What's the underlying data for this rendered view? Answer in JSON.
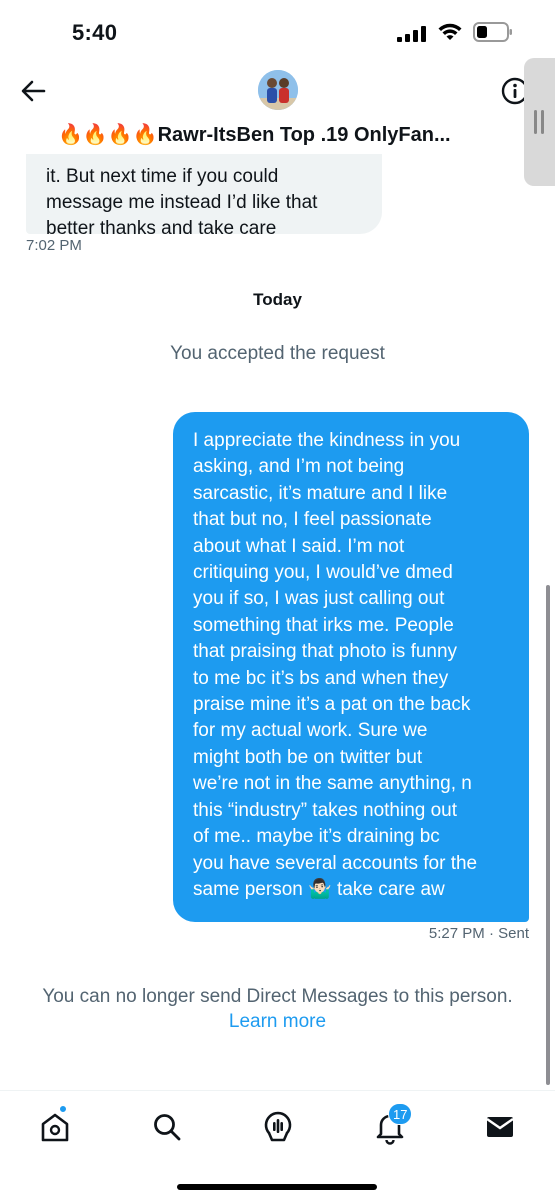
{
  "status_bar": {
    "time": "5:40"
  },
  "header": {
    "title": "🔥🔥🔥🔥Rawr-ItsBen Top .19 OnlyFan...",
    "back_icon": "arrow-left-icon",
    "info_icon": "info-icon"
  },
  "messages": {
    "received": {
      "lines": [
        "it. But next time if you could",
        "message me instead I’d like that",
        "better thanks and take care"
      ],
      "time": "7:02 PM"
    },
    "date_divider": "Today",
    "system": "You accepted the request",
    "sent": {
      "lines": [
        "I appreciate the kindness in you",
        "asking, and I’m not being",
        "sarcastic, it’s mature and I like",
        "that but no, I feel passionate",
        "about what I said. I’m not",
        "critiquing you, I would’ve dmed",
        "you if so, I was just calling out",
        "something that irks me. People",
        "that praising that photo is funny",
        "to me bc  it’s bs and when they",
        "praise mine it’s a pat on the back",
        "for my actual work. Sure we",
        "might both be on twitter but",
        "we’re not in the same anything, n",
        "this “industry” takes nothing out",
        "of me.. maybe it’s draining bc",
        "you have several accounts for the",
        "same person 🤷🏻‍♂️ take care aw"
      ],
      "time": "5:27 PM",
      "status": "· Sent"
    }
  },
  "notice": {
    "text": "You can no longer send Direct Messages to this person.",
    "link": "Learn more"
  },
  "tab_bar": {
    "items": [
      {
        "name": "home",
        "icon": "home-icon"
      },
      {
        "name": "search",
        "icon": "search-icon"
      },
      {
        "name": "spaces",
        "icon": "spaces-icon"
      },
      {
        "name": "notifications",
        "icon": "bell-icon"
      },
      {
        "name": "messages",
        "icon": "envelope-icon"
      }
    ],
    "notifications_count": "17"
  },
  "colors": {
    "accent": "#1d9bf0",
    "secondary_text": "#536471",
    "received_bubble": "#eff3f4"
  }
}
